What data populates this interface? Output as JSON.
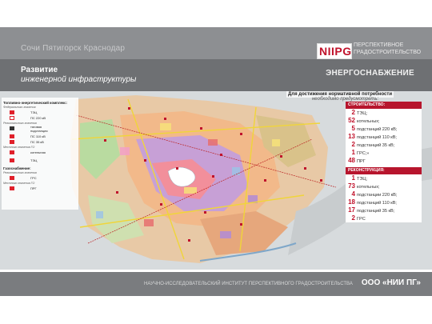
{
  "header": {
    "breadcrumb": "Сочи   Пятигорск    Краснодар",
    "logo_mark": "NIIPG",
    "logo_line1": "ПЕРСПЕКТИВНОЕ",
    "logo_line2": "ГРАДОСТРОИТЕЛЬСТВО",
    "title_line1": "Развитие",
    "title_line2": "инженерной инфраструктуры",
    "section": "ЭНЕРГОСНАБЖЕНИЕ"
  },
  "legend": {
    "heading_energy": "Топливно-энергетический комплекс:",
    "federal": "Федерального значения",
    "regional": "Регионального значения",
    "local": "Местного значения ГО",
    "items": [
      {
        "label": "ТЭЦ",
        "color": "#e0202a"
      },
      {
        "label": "ПС 220 кВ",
        "color": "#e0202a"
      },
      {
        "label": "тяговая подстанция",
        "color": "#333333"
      },
      {
        "label": "ПС 110 кВ",
        "color": "#e0202a"
      },
      {
        "label": "ПС 35 кВ",
        "color": "#e0202a"
      },
      {
        "label": "котельная",
        "color": "#e0202a"
      },
      {
        "label": "ТЭЦ",
        "color": "#e0202a"
      }
    ],
    "heading_gas": "Газоснабжение:",
    "gas_items": [
      {
        "label": "ГРС",
        "color": "#e0202a"
      },
      {
        "label": "ПРГ",
        "color": "#e0202a"
      }
    ]
  },
  "note": {
    "line1": "Для достижения нормативной потребности",
    "line2": "необходимо предусмотреть:"
  },
  "construction": {
    "heading": "СТРОИТЕЛЬСТВО:",
    "rows": [
      {
        "num": "2",
        "label": "ТЭЦ;"
      },
      {
        "num": "52",
        "label": "котельных;"
      },
      {
        "num": "5",
        "label": "подстанций 220 кВ;"
      },
      {
        "num": "13",
        "label": "подстанций 110 кВ;"
      },
      {
        "num": "2",
        "label": "подстанций 35 кВ;"
      },
      {
        "num": "1",
        "label": "ГРС;»"
      },
      {
        "num": "48",
        "label": "ПРГ"
      }
    ]
  },
  "reconstruction": {
    "heading": "РЕКОНСТРУКЦИЯ:",
    "rows": [
      {
        "num": "1",
        "label": "ТЭЦ;"
      },
      {
        "num": "73",
        "label": "котельных;"
      },
      {
        "num": "4",
        "label": "подстанции 220 кВ;"
      },
      {
        "num": "18",
        "label": "подстанций 110 кВ;"
      },
      {
        "num": "17",
        "label": "подстанций 35 кВ;"
      },
      {
        "num": "2",
        "label": "ГРС"
      }
    ]
  },
  "footer": {
    "institute": "НАУЧНО-ИССЛЕДОВАТЕЛЬСКИЙ ИНСТИТУТ ПЕРСПЕКТИВНОГО ГРАДОСТРОИТЕЛЬСТВА",
    "org": "ООО «НИИ ПГ»"
  },
  "colors": {
    "brand_red": "#c0122b",
    "band_gray": "#6e7073"
  }
}
